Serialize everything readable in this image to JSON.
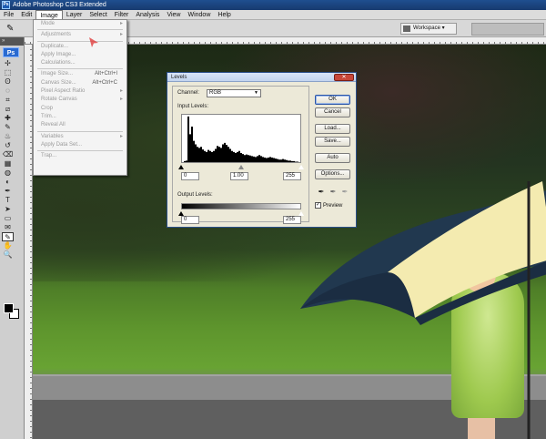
{
  "app": {
    "title": "Adobe Photoshop CS3 Extended",
    "logo": "Ps"
  },
  "menubar": [
    "File",
    "Edit",
    "Image",
    "Layer",
    "Select",
    "Filter",
    "Analysis",
    "View",
    "Window",
    "Help"
  ],
  "optionsbar": {
    "tool_icon": "eyedropper-icon",
    "workspace_label": "Workspace"
  },
  "toolbox": {
    "logo": "Ps",
    "tools": [
      "move",
      "marquee",
      "lasso",
      "quick-select",
      "crop",
      "slice",
      "healing",
      "brush",
      "stamp",
      "history-brush",
      "eraser",
      "gradient",
      "blur",
      "dodge",
      "pen",
      "type",
      "path-select",
      "shape",
      "notes",
      "eyedropper",
      "hand",
      "zoom"
    ]
  },
  "image_menu": {
    "items": [
      {
        "label": "Mode",
        "submenu": true,
        "disabled": true
      },
      {
        "sep": true
      },
      {
        "label": "Adjustments",
        "submenu": true,
        "disabled": true
      },
      {
        "sep": true
      },
      {
        "label": "Duplicate...",
        "disabled": true
      },
      {
        "label": "Apply Image...",
        "disabled": true
      },
      {
        "label": "Calculations...",
        "disabled": true
      },
      {
        "sep": true
      },
      {
        "label": "Image Size...",
        "shortcut": "Alt+Ctrl+I",
        "disabled": true
      },
      {
        "label": "Canvas Size...",
        "shortcut": "Alt+Ctrl+C",
        "disabled": true
      },
      {
        "label": "Pixel Aspect Ratio",
        "submenu": true,
        "disabled": true
      },
      {
        "label": "Rotate Canvas",
        "submenu": true,
        "disabled": true
      },
      {
        "label": "Crop",
        "disabled": true
      },
      {
        "label": "Trim...",
        "disabled": true
      },
      {
        "label": "Reveal All",
        "disabled": true
      },
      {
        "sep": true
      },
      {
        "label": "Variables",
        "submenu": true,
        "disabled": true
      },
      {
        "label": "Apply Data Set...",
        "disabled": true
      },
      {
        "sep": true
      },
      {
        "label": "Trap...",
        "disabled": true
      }
    ]
  },
  "levels": {
    "title": "Levels",
    "channel_label": "Channel:",
    "channel_value": "RGB",
    "input_levels_label": "Input Levels:",
    "input_black": "0",
    "input_gamma": "1.00",
    "input_white": "255",
    "output_levels_label": "Output Levels:",
    "output_black": "0",
    "output_white": "255",
    "buttons": {
      "ok": "OK",
      "cancel": "Cancel",
      "load": "Load...",
      "save": "Save...",
      "auto": "Auto",
      "options": "Options..."
    },
    "preview_label": "Preview",
    "preview_checked": true,
    "histogram": [
      0,
      2,
      3,
      90,
      55,
      70,
      42,
      35,
      30,
      28,
      30,
      25,
      22,
      20,
      24,
      22,
      20,
      22,
      26,
      32,
      30,
      28,
      35,
      38,
      34,
      30,
      26,
      22,
      20,
      18,
      20,
      22,
      18,
      16,
      14,
      15,
      14,
      13,
      12,
      11,
      10,
      12,
      14,
      12,
      10,
      9,
      8,
      9,
      10,
      9,
      8,
      7,
      6,
      5,
      5,
      6,
      5,
      4,
      3,
      3,
      2,
      2,
      1,
      1,
      0
    ]
  },
  "colors": {
    "titlebar": "#1f4f8f",
    "dialog_bg": "#ece9d8",
    "close_button": "#c8473a",
    "default_button_border": "#2a55a8"
  }
}
